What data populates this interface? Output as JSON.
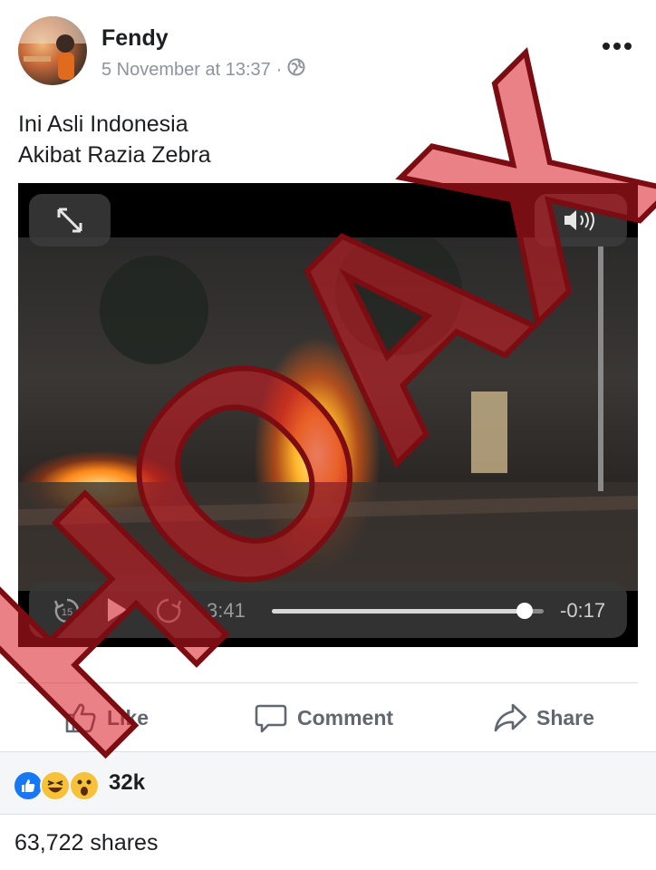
{
  "post": {
    "author": "Fendy",
    "timestamp": "5 November at 13:37",
    "separator": "·",
    "privacy_icon": "globe-icon",
    "text_lines": [
      "Ini Asli Indonesia",
      "Akibat Razia Zebra"
    ]
  },
  "video": {
    "elapsed": "3:41",
    "remaining": "-0:17",
    "progress_fraction": 0.93,
    "skip_back_label": "15",
    "icons": [
      "expand-icon",
      "volume-icon",
      "skip-back-icon",
      "play-icon",
      "skip-forward-icon"
    ],
    "overlay_stamp": "HOAX",
    "stamp_color": "#c8202a"
  },
  "actions": {
    "like": "Like",
    "comment": "Comment",
    "share": "Share"
  },
  "reactions": {
    "icons": [
      "like-reaction-icon",
      "haha-reaction-icon",
      "wow-reaction-icon"
    ],
    "count": "32k"
  },
  "shares": "63,722 shares",
  "colors": {
    "text": "#1c1e21",
    "secondary": "#8d949e",
    "action": "#606770",
    "like_blue": "#1877f2"
  }
}
